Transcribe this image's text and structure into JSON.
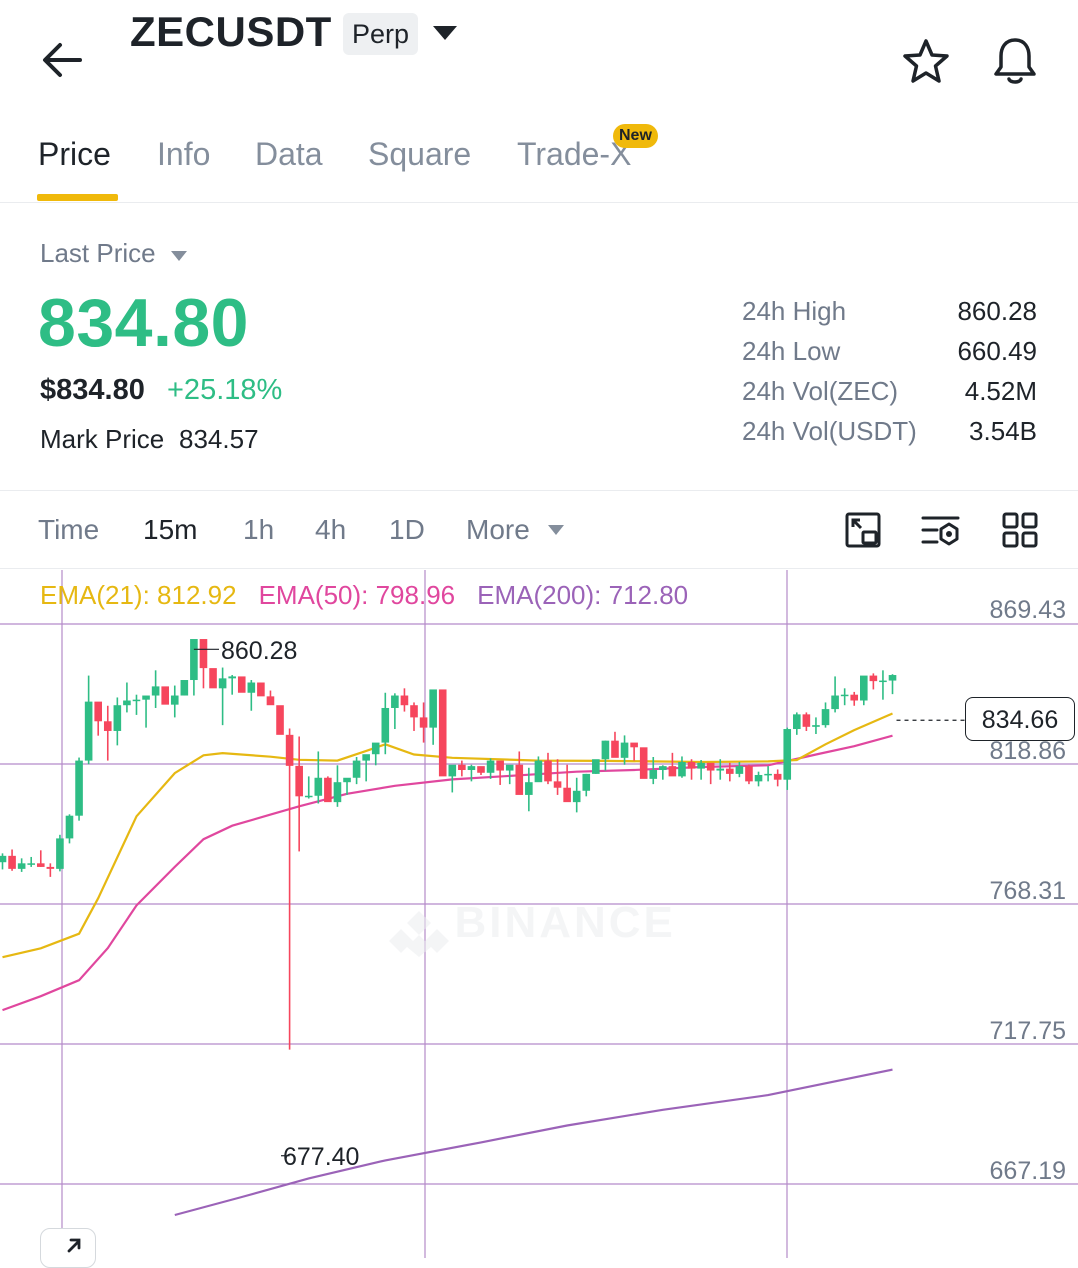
{
  "header": {
    "symbol": "ZECUSDT",
    "badge": "Perp"
  },
  "tabs": [
    {
      "label": "Price",
      "active": true
    },
    {
      "label": "Info"
    },
    {
      "label": "Data"
    },
    {
      "label": "Square"
    },
    {
      "label": "Trade-X",
      "badge": "New"
    }
  ],
  "price": {
    "label": "Last Price",
    "value": "834.80",
    "usd": "$834.80",
    "change": "+25.18%",
    "mark_label": "Mark Price",
    "mark_value": "834.57"
  },
  "stats": [
    {
      "label": "24h High",
      "value": "860.28"
    },
    {
      "label": "24h Low",
      "value": "660.49"
    },
    {
      "label": "24h Vol(ZEC)",
      "value": "4.52M"
    },
    {
      "label": "24h Vol(USDT)",
      "value": "3.54B"
    }
  ],
  "timeframes": [
    "Time",
    "15m",
    "1h",
    "4h",
    "1D",
    "More"
  ],
  "active_timeframe": "15m",
  "chart": {
    "watermark": "BINANCE",
    "ema21_label": "EMA(21): 812.92",
    "ema50_label": "EMA(50): 798.96",
    "ema200_label": "EMA(200): 712.80",
    "current_price_tag": "834.66",
    "high_marker": "860.28",
    "low_marker": "677.40",
    "colors": {
      "up": "#2ebd85",
      "down": "#f6465d",
      "ema21": "#e6b812",
      "ema50": "#e0479e",
      "ema200": "#9b63b8",
      "grid": "#b58bc9"
    }
  },
  "chart_data": {
    "type": "candlestick",
    "y_axis_labels": [
      "869.43",
      "818.86",
      "768.31",
      "717.75",
      "667.19"
    ],
    "ylim": [
      667.19,
      869.43
    ],
    "candles": [
      [
        783.4,
        786.6,
        780.8,
        785.7
      ],
      [
        785.7,
        788.0,
        780.3,
        781.0
      ],
      [
        781.0,
        784.8,
        779.9,
        783.0
      ],
      [
        783.0,
        785.3,
        781.7,
        783.0
      ],
      [
        783.0,
        787.7,
        781.7,
        781.7
      ],
      [
        781.7,
        783.0,
        778.1,
        781.0
      ],
      [
        781.0,
        793.3,
        780.1,
        792.0
      ],
      [
        792.0,
        800.7,
        790.2,
        800.2
      ],
      [
        800.2,
        821.2,
        798.4,
        820.1
      ],
      [
        820.1,
        850.8,
        818.8,
        841.4
      ],
      [
        841.4,
        839.9,
        829.1,
        834.3
      ],
      [
        834.3,
        839.9,
        820.1,
        830.8
      ],
      [
        830.8,
        842.9,
        825.6,
        840.1
      ],
      [
        840.1,
        848.3,
        837.5,
        841.8
      ],
      [
        841.8,
        843.9,
        836.6,
        842.1
      ],
      [
        842.1,
        843.1,
        832.0,
        843.6
      ],
      [
        843.6,
        852.7,
        839.1,
        846.9
      ],
      [
        846.9,
        845.9,
        840.7,
        840.3
      ],
      [
        840.3,
        847.2,
        835.7,
        843.6
      ],
      [
        843.6,
        848.3,
        843.6,
        849.2
      ],
      [
        849.2,
        853.5,
        843.6,
        864.0
      ],
      [
        864.0,
        856.7,
        846.2,
        853.5
      ],
      [
        853.5,
        852.9,
        848.8,
        846.2
      ],
      [
        846.2,
        853.7,
        832.9,
        849.8
      ],
      [
        849.8,
        851.0,
        843.9,
        850.5
      ],
      [
        850.5,
        849.2,
        844.9,
        844.6
      ],
      [
        844.6,
        849.2,
        838.1,
        848.3
      ],
      [
        848.3,
        848.3,
        843.9,
        843.3
      ],
      [
        843.3,
        845.4,
        841.8,
        840.1
      ],
      [
        840.1,
        839.2,
        833.9,
        829.4
      ],
      [
        829.4,
        831.7,
        715.7,
        818.2
      ],
      [
        818.2,
        828.8,
        787.3,
        807.2
      ],
      [
        807.2,
        814.4,
        806.4,
        807.4
      ],
      [
        807.4,
        823.4,
        804.6,
        813.9
      ],
      [
        813.9,
        814.4,
        808.6,
        805.1
      ],
      [
        805.1,
        818.4,
        803.4,
        812.3
      ],
      [
        812.3,
        812.6,
        807.7,
        813.9
      ],
      [
        813.9,
        821.4,
        811.6,
        820.1
      ],
      [
        820.1,
        821.6,
        812.6,
        822.4
      ],
      [
        822.4,
        826.4,
        818.4,
        826.6
      ],
      [
        826.6,
        844.6,
        822.4,
        839.1
      ],
      [
        839.1,
        844.4,
        831.5,
        843.6
      ],
      [
        843.6,
        846.2,
        837.8,
        840.1
      ],
      [
        840.1,
        841.1,
        830.8,
        835.7
      ],
      [
        835.7,
        841.1,
        826.6,
        832.0
      ],
      [
        832.0,
        844.1,
        825.8,
        845.8
      ],
      [
        845.8,
        844.6,
        815.5,
        814.4
      ],
      [
        814.4,
        816.9,
        808.6,
        818.6
      ],
      [
        818.6,
        820.1,
        814.4,
        816.7
      ],
      [
        816.7,
        818.6,
        812.6,
        818.1
      ],
      [
        818.1,
        816.1,
        814.9,
        815.7
      ],
      [
        815.7,
        820.9,
        813.5,
        820.1
      ],
      [
        820.1,
        817.5,
        811.3,
        816.5
      ],
      [
        816.5,
        817.7,
        811.6,
        818.6
      ],
      [
        818.6,
        823.4,
        813.2,
        807.7
      ],
      [
        807.7,
        817.5,
        801.8,
        812.3
      ],
      [
        812.3,
        821.6,
        813.2,
        820.1
      ],
      [
        820.1,
        822.9,
        811.6,
        812.6
      ],
      [
        812.6,
        820.6,
        807.7,
        810.3
      ],
      [
        810.3,
        818.6,
        806.4,
        805.1
      ],
      [
        805.1,
        813.9,
        801.4,
        809.2
      ],
      [
        809.2,
        815.3,
        807.2,
        815.3
      ],
      [
        815.3,
        819.6,
        815.3,
        820.6
      ],
      [
        820.6,
        827.3,
        816.5,
        827.3
      ],
      [
        827.3,
        830.5,
        822.4,
        821.1
      ],
      [
        821.1,
        829.2,
        818.6,
        826.6
      ],
      [
        826.6,
        825.8,
        820.1,
        824.9
      ],
      [
        824.9,
        821.6,
        814.4,
        813.5
      ],
      [
        813.5,
        821.4,
        811.6,
        816.7
      ],
      [
        816.7,
        818.4,
        813.2,
        818.1
      ],
      [
        818.1,
        822.9,
        815.5,
        814.4
      ],
      [
        814.4,
        821.6,
        813.9,
        819.6
      ],
      [
        819.6,
        820.6,
        813.2,
        817.2
      ],
      [
        817.2,
        820.3,
        813.2,
        819.3
      ],
      [
        819.3,
        817.7,
        811.6,
        816.5
      ],
      [
        816.5,
        820.6,
        813.2,
        817.2
      ],
      [
        817.2,
        819.3,
        812.6,
        815.3
      ],
      [
        815.3,
        819.6,
        814.1,
        818.1
      ],
      [
        818.1,
        818.6,
        811.6,
        812.6
      ],
      [
        812.6,
        816.1,
        810.8,
        814.9
      ],
      [
        814.9,
        818.1,
        812.6,
        815.3
      ],
      [
        815.3,
        816.9,
        810.8,
        813.2
      ],
      [
        813.2,
        832.0,
        809.5,
        831.5
      ],
      [
        831.5,
        837.5,
        829.4,
        836.8
      ],
      [
        836.8,
        837.5,
        830.8,
        832.3
      ],
      [
        832.3,
        835.7,
        829.7,
        832.9
      ],
      [
        832.9,
        841.1,
        832.0,
        838.7
      ],
      [
        838.7,
        850.5,
        837.5,
        843.6
      ],
      [
        843.6,
        846.2,
        840.1,
        843.9
      ],
      [
        843.9,
        844.9,
        839.9,
        841.8
      ],
      [
        841.8,
        849.8,
        840.1,
        850.8
      ],
      [
        850.8,
        851.6,
        845.8,
        848.8
      ],
      [
        848.8,
        852.7,
        842.1,
        849.0
      ],
      [
        849.0,
        851.3,
        844.1,
        851.0
      ]
    ],
    "ema21": [
      [
        0,
        749.1
      ],
      [
        4,
        752.3
      ],
      [
        8,
        757.6
      ],
      [
        10,
        770.4
      ],
      [
        14,
        800.0
      ],
      [
        18,
        815.6
      ],
      [
        21,
        822.0
      ],
      [
        23,
        822.8
      ],
      [
        28,
        821.5
      ],
      [
        31,
        820.4
      ],
      [
        35,
        820.1
      ],
      [
        38,
        823.6
      ],
      [
        40,
        826.0
      ],
      [
        43,
        822.3
      ],
      [
        47,
        821.1
      ],
      [
        56,
        820.1
      ],
      [
        63,
        820.0
      ],
      [
        68,
        819.8
      ],
      [
        73,
        819.6
      ],
      [
        80,
        819.8
      ],
      [
        83,
        820.3
      ],
      [
        86,
        826.0
      ],
      [
        89,
        831.1
      ],
      [
        93,
        837.1
      ]
    ],
    "ema50": [
      [
        0,
        730.0
      ],
      [
        4,
        735.0
      ],
      [
        8,
        740.8
      ],
      [
        11,
        752.4
      ],
      [
        14,
        767.8
      ],
      [
        18,
        781.7
      ],
      [
        21,
        791.7
      ],
      [
        24,
        796.6
      ],
      [
        28,
        800.6
      ],
      [
        31,
        803.6
      ],
      [
        36,
        808.1
      ],
      [
        41,
        811.0
      ],
      [
        47,
        813.3
      ],
      [
        54,
        814.8
      ],
      [
        60,
        816.1
      ],
      [
        66,
        816.7
      ],
      [
        73,
        817.8
      ],
      [
        80,
        818.4
      ],
      [
        85,
        822.3
      ],
      [
        89,
        825.3
      ],
      [
        93,
        829.1
      ]
    ],
    "ema200": [
      [
        18,
        656.0
      ],
      [
        25,
        662.5
      ],
      [
        32,
        669.2
      ],
      [
        40,
        675.7
      ],
      [
        50,
        682.2
      ],
      [
        59,
        688.3
      ],
      [
        69,
        694.0
      ],
      [
        80,
        699.3
      ],
      [
        93,
        708.5
      ]
    ]
  },
  "buttons": {
    "expand_icon": "expand-arrow-icon"
  }
}
